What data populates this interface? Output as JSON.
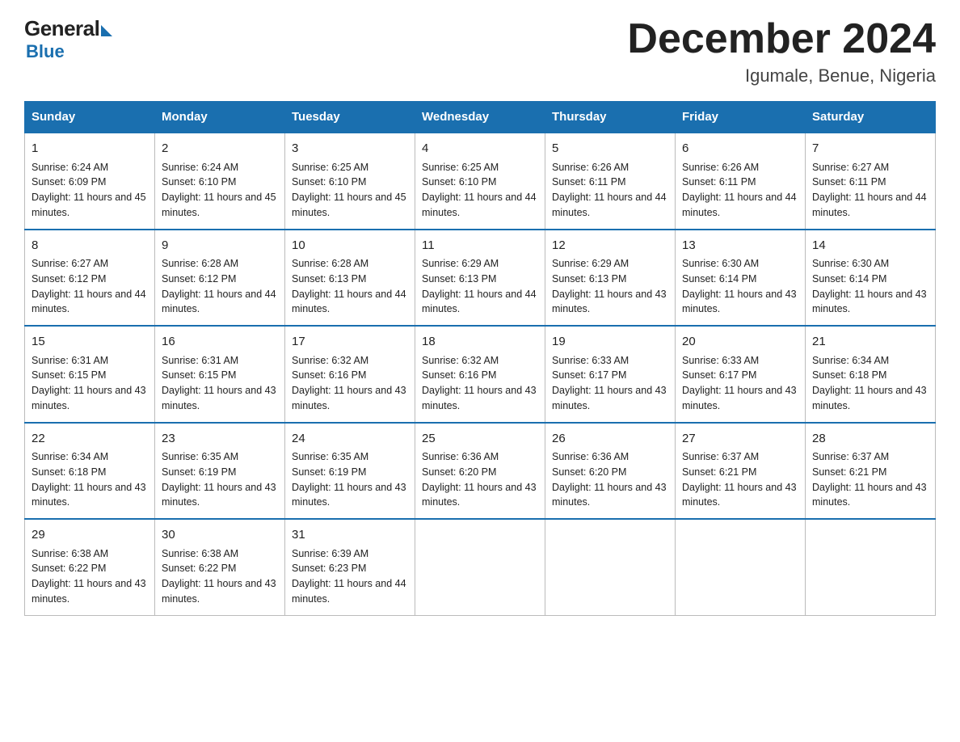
{
  "header": {
    "logo_general": "General",
    "logo_blue": "Blue",
    "title": "December 2024",
    "subtitle": "Igumale, Benue, Nigeria"
  },
  "days_of_week": [
    "Sunday",
    "Monday",
    "Tuesday",
    "Wednesday",
    "Thursday",
    "Friday",
    "Saturday"
  ],
  "weeks": [
    [
      {
        "day": "1",
        "sunrise": "6:24 AM",
        "sunset": "6:09 PM",
        "daylight": "11 hours and 45 minutes."
      },
      {
        "day": "2",
        "sunrise": "6:24 AM",
        "sunset": "6:10 PM",
        "daylight": "11 hours and 45 minutes."
      },
      {
        "day": "3",
        "sunrise": "6:25 AM",
        "sunset": "6:10 PM",
        "daylight": "11 hours and 45 minutes."
      },
      {
        "day": "4",
        "sunrise": "6:25 AM",
        "sunset": "6:10 PM",
        "daylight": "11 hours and 44 minutes."
      },
      {
        "day": "5",
        "sunrise": "6:26 AM",
        "sunset": "6:11 PM",
        "daylight": "11 hours and 44 minutes."
      },
      {
        "day": "6",
        "sunrise": "6:26 AM",
        "sunset": "6:11 PM",
        "daylight": "11 hours and 44 minutes."
      },
      {
        "day": "7",
        "sunrise": "6:27 AM",
        "sunset": "6:11 PM",
        "daylight": "11 hours and 44 minutes."
      }
    ],
    [
      {
        "day": "8",
        "sunrise": "6:27 AM",
        "sunset": "6:12 PM",
        "daylight": "11 hours and 44 minutes."
      },
      {
        "day": "9",
        "sunrise": "6:28 AM",
        "sunset": "6:12 PM",
        "daylight": "11 hours and 44 minutes."
      },
      {
        "day": "10",
        "sunrise": "6:28 AM",
        "sunset": "6:13 PM",
        "daylight": "11 hours and 44 minutes."
      },
      {
        "day": "11",
        "sunrise": "6:29 AM",
        "sunset": "6:13 PM",
        "daylight": "11 hours and 44 minutes."
      },
      {
        "day": "12",
        "sunrise": "6:29 AM",
        "sunset": "6:13 PM",
        "daylight": "11 hours and 43 minutes."
      },
      {
        "day": "13",
        "sunrise": "6:30 AM",
        "sunset": "6:14 PM",
        "daylight": "11 hours and 43 minutes."
      },
      {
        "day": "14",
        "sunrise": "6:30 AM",
        "sunset": "6:14 PM",
        "daylight": "11 hours and 43 minutes."
      }
    ],
    [
      {
        "day": "15",
        "sunrise": "6:31 AM",
        "sunset": "6:15 PM",
        "daylight": "11 hours and 43 minutes."
      },
      {
        "day": "16",
        "sunrise": "6:31 AM",
        "sunset": "6:15 PM",
        "daylight": "11 hours and 43 minutes."
      },
      {
        "day": "17",
        "sunrise": "6:32 AM",
        "sunset": "6:16 PM",
        "daylight": "11 hours and 43 minutes."
      },
      {
        "day": "18",
        "sunrise": "6:32 AM",
        "sunset": "6:16 PM",
        "daylight": "11 hours and 43 minutes."
      },
      {
        "day": "19",
        "sunrise": "6:33 AM",
        "sunset": "6:17 PM",
        "daylight": "11 hours and 43 minutes."
      },
      {
        "day": "20",
        "sunrise": "6:33 AM",
        "sunset": "6:17 PM",
        "daylight": "11 hours and 43 minutes."
      },
      {
        "day": "21",
        "sunrise": "6:34 AM",
        "sunset": "6:18 PM",
        "daylight": "11 hours and 43 minutes."
      }
    ],
    [
      {
        "day": "22",
        "sunrise": "6:34 AM",
        "sunset": "6:18 PM",
        "daylight": "11 hours and 43 minutes."
      },
      {
        "day": "23",
        "sunrise": "6:35 AM",
        "sunset": "6:19 PM",
        "daylight": "11 hours and 43 minutes."
      },
      {
        "day": "24",
        "sunrise": "6:35 AM",
        "sunset": "6:19 PM",
        "daylight": "11 hours and 43 minutes."
      },
      {
        "day": "25",
        "sunrise": "6:36 AM",
        "sunset": "6:20 PM",
        "daylight": "11 hours and 43 minutes."
      },
      {
        "day": "26",
        "sunrise": "6:36 AM",
        "sunset": "6:20 PM",
        "daylight": "11 hours and 43 minutes."
      },
      {
        "day": "27",
        "sunrise": "6:37 AM",
        "sunset": "6:21 PM",
        "daylight": "11 hours and 43 minutes."
      },
      {
        "day": "28",
        "sunrise": "6:37 AM",
        "sunset": "6:21 PM",
        "daylight": "11 hours and 43 minutes."
      }
    ],
    [
      {
        "day": "29",
        "sunrise": "6:38 AM",
        "sunset": "6:22 PM",
        "daylight": "11 hours and 43 minutes."
      },
      {
        "day": "30",
        "sunrise": "6:38 AM",
        "sunset": "6:22 PM",
        "daylight": "11 hours and 43 minutes."
      },
      {
        "day": "31",
        "sunrise": "6:39 AM",
        "sunset": "6:23 PM",
        "daylight": "11 hours and 44 minutes."
      },
      null,
      null,
      null,
      null
    ]
  ],
  "labels": {
    "sunrise": "Sunrise:",
    "sunset": "Sunset:",
    "daylight": "Daylight:"
  }
}
